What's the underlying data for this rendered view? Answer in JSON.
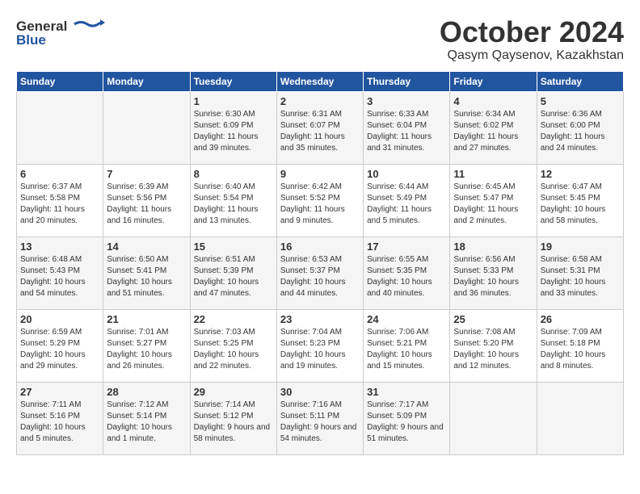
{
  "header": {
    "logo_line1": "General",
    "logo_line2": "Blue",
    "title": "October 2024",
    "subtitle": "Qasym Qaysenov, Kazakhstan"
  },
  "weekdays": [
    "Sunday",
    "Monday",
    "Tuesday",
    "Wednesday",
    "Thursday",
    "Friday",
    "Saturday"
  ],
  "weeks": [
    [
      {
        "day": "",
        "info": ""
      },
      {
        "day": "",
        "info": ""
      },
      {
        "day": "1",
        "info": "Sunrise: 6:30 AM\nSunset: 6:09 PM\nDaylight: 11 hours and 39 minutes."
      },
      {
        "day": "2",
        "info": "Sunrise: 6:31 AM\nSunset: 6:07 PM\nDaylight: 11 hours and 35 minutes."
      },
      {
        "day": "3",
        "info": "Sunrise: 6:33 AM\nSunset: 6:04 PM\nDaylight: 11 hours and 31 minutes."
      },
      {
        "day": "4",
        "info": "Sunrise: 6:34 AM\nSunset: 6:02 PM\nDaylight: 11 hours and 27 minutes."
      },
      {
        "day": "5",
        "info": "Sunrise: 6:36 AM\nSunset: 6:00 PM\nDaylight: 11 hours and 24 minutes."
      }
    ],
    [
      {
        "day": "6",
        "info": "Sunrise: 6:37 AM\nSunset: 5:58 PM\nDaylight: 11 hours and 20 minutes."
      },
      {
        "day": "7",
        "info": "Sunrise: 6:39 AM\nSunset: 5:56 PM\nDaylight: 11 hours and 16 minutes."
      },
      {
        "day": "8",
        "info": "Sunrise: 6:40 AM\nSunset: 5:54 PM\nDaylight: 11 hours and 13 minutes."
      },
      {
        "day": "9",
        "info": "Sunrise: 6:42 AM\nSunset: 5:52 PM\nDaylight: 11 hours and 9 minutes."
      },
      {
        "day": "10",
        "info": "Sunrise: 6:44 AM\nSunset: 5:49 PM\nDaylight: 11 hours and 5 minutes."
      },
      {
        "day": "11",
        "info": "Sunrise: 6:45 AM\nSunset: 5:47 PM\nDaylight: 11 hours and 2 minutes."
      },
      {
        "day": "12",
        "info": "Sunrise: 6:47 AM\nSunset: 5:45 PM\nDaylight: 10 hours and 58 minutes."
      }
    ],
    [
      {
        "day": "13",
        "info": "Sunrise: 6:48 AM\nSunset: 5:43 PM\nDaylight: 10 hours and 54 minutes."
      },
      {
        "day": "14",
        "info": "Sunrise: 6:50 AM\nSunset: 5:41 PM\nDaylight: 10 hours and 51 minutes."
      },
      {
        "day": "15",
        "info": "Sunrise: 6:51 AM\nSunset: 5:39 PM\nDaylight: 10 hours and 47 minutes."
      },
      {
        "day": "16",
        "info": "Sunrise: 6:53 AM\nSunset: 5:37 PM\nDaylight: 10 hours and 44 minutes."
      },
      {
        "day": "17",
        "info": "Sunrise: 6:55 AM\nSunset: 5:35 PM\nDaylight: 10 hours and 40 minutes."
      },
      {
        "day": "18",
        "info": "Sunrise: 6:56 AM\nSunset: 5:33 PM\nDaylight: 10 hours and 36 minutes."
      },
      {
        "day": "19",
        "info": "Sunrise: 6:58 AM\nSunset: 5:31 PM\nDaylight: 10 hours and 33 minutes."
      }
    ],
    [
      {
        "day": "20",
        "info": "Sunrise: 6:59 AM\nSunset: 5:29 PM\nDaylight: 10 hours and 29 minutes."
      },
      {
        "day": "21",
        "info": "Sunrise: 7:01 AM\nSunset: 5:27 PM\nDaylight: 10 hours and 26 minutes."
      },
      {
        "day": "22",
        "info": "Sunrise: 7:03 AM\nSunset: 5:25 PM\nDaylight: 10 hours and 22 minutes."
      },
      {
        "day": "23",
        "info": "Sunrise: 7:04 AM\nSunset: 5:23 PM\nDaylight: 10 hours and 19 minutes."
      },
      {
        "day": "24",
        "info": "Sunrise: 7:06 AM\nSunset: 5:21 PM\nDaylight: 10 hours and 15 minutes."
      },
      {
        "day": "25",
        "info": "Sunrise: 7:08 AM\nSunset: 5:20 PM\nDaylight: 10 hours and 12 minutes."
      },
      {
        "day": "26",
        "info": "Sunrise: 7:09 AM\nSunset: 5:18 PM\nDaylight: 10 hours and 8 minutes."
      }
    ],
    [
      {
        "day": "27",
        "info": "Sunrise: 7:11 AM\nSunset: 5:16 PM\nDaylight: 10 hours and 5 minutes."
      },
      {
        "day": "28",
        "info": "Sunrise: 7:12 AM\nSunset: 5:14 PM\nDaylight: 10 hours and 1 minute."
      },
      {
        "day": "29",
        "info": "Sunrise: 7:14 AM\nSunset: 5:12 PM\nDaylight: 9 hours and 58 minutes."
      },
      {
        "day": "30",
        "info": "Sunrise: 7:16 AM\nSunset: 5:11 PM\nDaylight: 9 hours and 54 minutes."
      },
      {
        "day": "31",
        "info": "Sunrise: 7:17 AM\nSunset: 5:09 PM\nDaylight: 9 hours and 51 minutes."
      },
      {
        "day": "",
        "info": ""
      },
      {
        "day": "",
        "info": ""
      }
    ]
  ]
}
